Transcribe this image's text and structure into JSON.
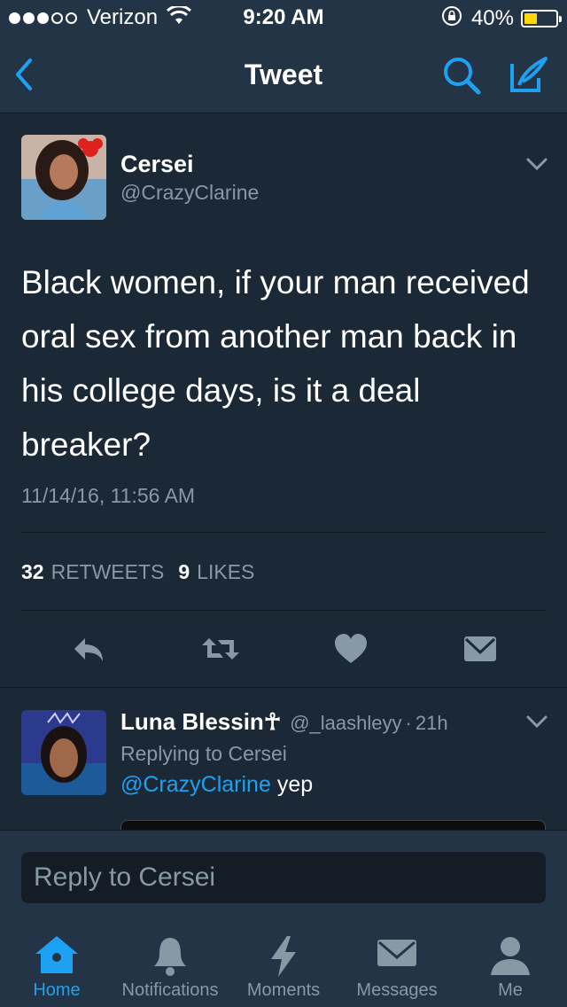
{
  "status_bar": {
    "carrier": "Verizon",
    "signal_bars": 3,
    "time": "9:20 AM",
    "battery_percent_label": "40%",
    "battery_level": 0.4,
    "battery_color": "#ffd60a",
    "icons": [
      "wifi-icon",
      "rotation-lock-icon",
      "battery-icon"
    ]
  },
  "nav": {
    "title": "Tweet",
    "icons": [
      "back-chevron-icon",
      "search-icon",
      "compose-icon"
    ]
  },
  "tweet": {
    "author_name": "Cersei",
    "author_handle": "@CrazyClarine",
    "text": "Black women, if your man received oral sex from another man back in his college days, is it a deal breaker?",
    "timestamp": "11/14/16, 11:56 AM",
    "retweets_count": "32",
    "retweets_label": "RETWEETS",
    "likes_count": "9",
    "likes_label": "LIKES",
    "actions": [
      "reply-icon",
      "retweet-icon",
      "like-icon",
      "direct-message-icon"
    ]
  },
  "reply": {
    "author_name": "Luna Blessin☥",
    "author_handle": "@_laashleyy",
    "separator": "·",
    "time_ago": "21h",
    "replying_to": "Replying to Cersei",
    "mention": "@CrazyClarine",
    "text": "yep"
  },
  "compose": {
    "placeholder": "Reply to Cersei"
  },
  "tabs": [
    {
      "label": "Home",
      "icon": "home-icon",
      "active": true
    },
    {
      "label": "Notifications",
      "icon": "bell-icon",
      "active": false
    },
    {
      "label": "Moments",
      "icon": "lightning-icon",
      "active": false
    },
    {
      "label": "Messages",
      "icon": "envelope-icon",
      "active": false
    },
    {
      "label": "Me",
      "icon": "person-icon",
      "active": false
    }
  ],
  "colors": {
    "accent": "#1da1f2",
    "background": "#1b2836",
    "bar_background": "#243447",
    "secondary_text": "#8899a6"
  }
}
